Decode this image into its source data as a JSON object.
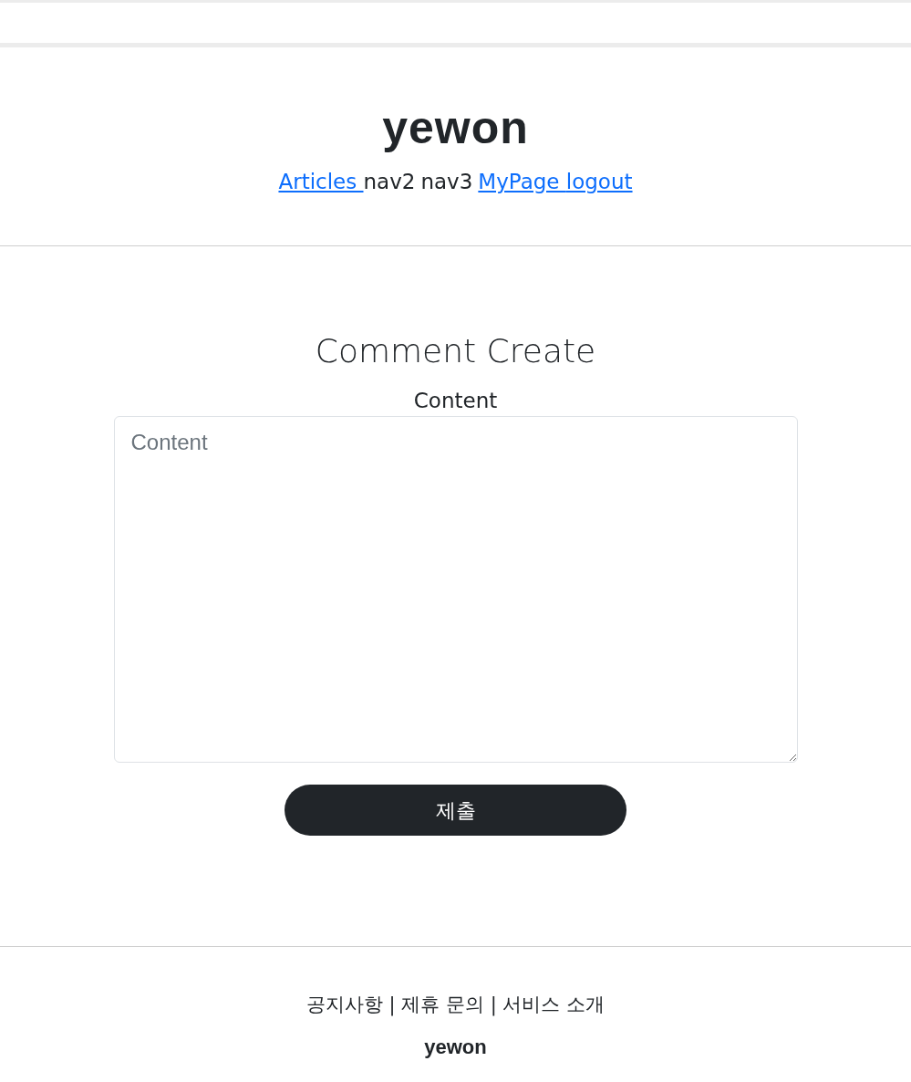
{
  "header": {
    "logo": "yewon",
    "nav": [
      {
        "label": "Articles ",
        "kind": "link"
      },
      {
        "label": "nav2",
        "kind": "text"
      },
      {
        "label": "nav3",
        "kind": "text"
      },
      {
        "label": "MyPage ",
        "kind": "link"
      },
      {
        "label": "logout",
        "kind": "link"
      }
    ]
  },
  "form": {
    "title": "Comment Create",
    "label": "Content",
    "placeholder": "Content",
    "submit": "제출"
  },
  "footer": {
    "links": "공지사항 | 제휴 문의 | 서비스 소개",
    "logo": "yewon"
  }
}
